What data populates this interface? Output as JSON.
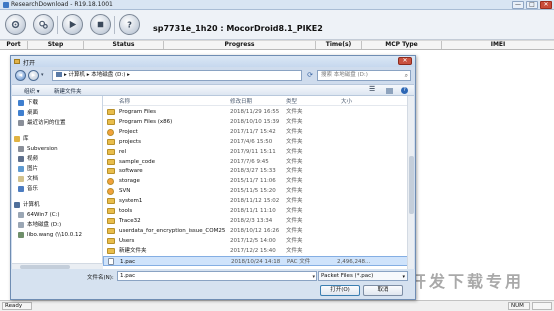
{
  "app": {
    "title": "ResearchDownload - R19.18.1001",
    "project_title": "sp7731e_1h20 : MocorDroid8.1_PIKE2",
    "window_buttons": [
      "—",
      "□",
      "✕"
    ]
  },
  "grid": {
    "columns": [
      "Port",
      "Step",
      "Status",
      "Progress",
      "Time(s)",
      "MCP Type",
      "IMEI"
    ]
  },
  "status_bar": {
    "ready_text": "Ready",
    "num_text": "NUM"
  },
  "watermark_text": "开发下载专用",
  "dialog": {
    "title": "打开",
    "address_path": "▸ 计算机 ▸ 本地磁盘 (D:) ▸",
    "search_placeholder": "搜索 本地磁盘 (D:)",
    "toolbar": {
      "organize": "组织 ▾",
      "new_folder": "新建文件夹"
    },
    "nav_items": [
      {
        "label": "下载",
        "icon": "downloads-folder-icon",
        "color": "#3f7fcf"
      },
      {
        "label": "桌面",
        "icon": "desktop-icon",
        "color": "#3f7fcf"
      },
      {
        "label": "最近访问的位置",
        "icon": "recent-places-icon",
        "color": "#8a8f99"
      },
      {
        "label": "库",
        "icon": "libraries-icon",
        "color": "#e1b343"
      },
      {
        "label": "Subversion",
        "icon": "subversion-icon",
        "color": "#8a8f99"
      },
      {
        "label": "视频",
        "icon": "videos-icon",
        "color": "#5e6f8c"
      },
      {
        "label": "图片",
        "icon": "pictures-icon",
        "color": "#5d9ad1"
      },
      {
        "label": "文档",
        "icon": "documents-icon",
        "color": "#d2c28c"
      },
      {
        "label": "音乐",
        "icon": "music-icon",
        "color": "#4c7cc0"
      },
      {
        "label": "计算机",
        "icon": "computer-icon",
        "color": "#4f6f9a"
      },
      {
        "label": "64Win7 (C:)",
        "icon": "drive-icon",
        "color": "#9aa6b4"
      },
      {
        "label": "本地磁盘 (D:)",
        "icon": "drive-icon",
        "color": "#9aa6b4"
      },
      {
        "label": "libo.wang (\\\\10.0.12",
        "icon": "network-drive-icon",
        "color": "#6f8f6a"
      }
    ],
    "file_list_headers": {
      "name": "名称",
      "date": "修改日期",
      "type": "类型",
      "size": "大小"
    },
    "files": [
      {
        "name": "Program Files",
        "date": "2018/11/29 16:55",
        "type": "文件夹",
        "size": "",
        "kind": "folder"
      },
      {
        "name": "Program Files (x86)",
        "date": "2018/10/10 15:39",
        "type": "文件夹",
        "size": "",
        "kind": "folder"
      },
      {
        "name": "Project",
        "date": "2017/11/7 15:42",
        "type": "文件夹",
        "size": "",
        "kind": "special"
      },
      {
        "name": "projects",
        "date": "2017/4/6 15:50",
        "type": "文件夹",
        "size": "",
        "kind": "folder"
      },
      {
        "name": "rel",
        "date": "2017/9/11 15:11",
        "type": "文件夹",
        "size": "",
        "kind": "folder"
      },
      {
        "name": "sample_code",
        "date": "2017/7/6 9:45",
        "type": "文件夹",
        "size": "",
        "kind": "folder"
      },
      {
        "name": "software",
        "date": "2018/3/27 15:33",
        "type": "文件夹",
        "size": "",
        "kind": "folder"
      },
      {
        "name": "storage",
        "date": "2015/11/7 11:06",
        "type": "文件夹",
        "size": "",
        "kind": "special"
      },
      {
        "name": "SVN",
        "date": "2015/11/5 15:20",
        "type": "文件夹",
        "size": "",
        "kind": "special"
      },
      {
        "name": "system1",
        "date": "2018/11/12 15:02",
        "type": "文件夹",
        "size": "",
        "kind": "folder"
      },
      {
        "name": "tools",
        "date": "2018/11/1 11:10",
        "type": "文件夹",
        "size": "",
        "kind": "folder"
      },
      {
        "name": "Trace32",
        "date": "2018/2/3 13:34",
        "type": "文件夹",
        "size": "",
        "kind": "folder"
      },
      {
        "name": "userdata_for_encryption_issue_COM25",
        "date": "2018/10/12 16:26",
        "type": "文件夹",
        "size": "",
        "kind": "folder"
      },
      {
        "name": "Users",
        "date": "2017/12/5 14:00",
        "type": "文件夹",
        "size": "",
        "kind": "folder"
      },
      {
        "name": "新建文件夹",
        "date": "2017/12/2 15:40",
        "type": "文件夹",
        "size": "",
        "kind": "folder"
      },
      {
        "name": "1.pac",
        "date": "2018/10/24 14:18",
        "type": "PAC 文件",
        "size": "2,496,248...",
        "kind": "file"
      }
    ],
    "filename_label": "文件名(N):",
    "filename_value": "1.pac",
    "filetype_value": "Packet Files (*.pac)",
    "open_label": "打开(O)",
    "cancel_label": "取消",
    "close_glyph": "✕"
  }
}
